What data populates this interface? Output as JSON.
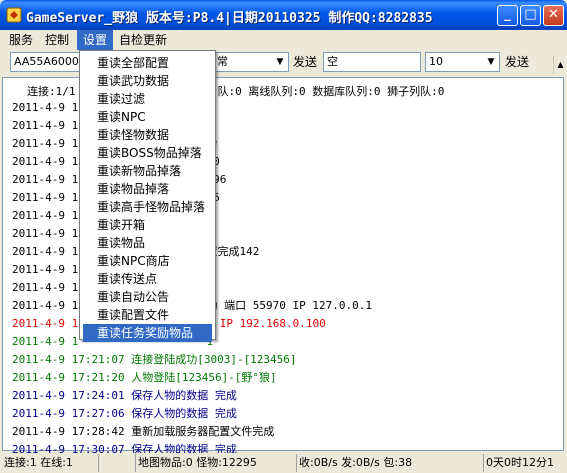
{
  "window": {
    "title": "GameServer_野狼 版本号:P8.4|日期20110325 制作QQ:8282835",
    "buttons": {
      "minimize": "_",
      "maximize": "□",
      "close": "✕"
    }
  },
  "menu": [
    {
      "label": "服务"
    },
    {
      "label": "控制"
    },
    {
      "label": "设置"
    },
    {
      "label": "自检更新"
    }
  ],
  "toolbar": {
    "combo1_value": "AA55A60000",
    "combo2_value": "常",
    "send1_label": "发送",
    "text_value": "空",
    "combo3_value": "10",
    "send2_label": "发送"
  },
  "dropdown": {
    "items": [
      "重读全部配置",
      "重读武功数据",
      "重读过滤",
      "重读NPC",
      "重读怪物数据",
      "重读BOSS物品掉落",
      "重读新物品掉落",
      "重读物品掉落",
      "重读高手怪物品掉落",
      "重读开箱",
      "重读物品",
      "重读NPC商店",
      "重读传送点",
      "重读自动公告",
      "重读配置文件",
      "重读任务奖励物品"
    ],
    "highlighted_index": 15
  },
  "log": {
    "connection_line_left": "连接:1/1",
    "connection_line_right": "队:0 离线队列:0 数据库队列:0 狮子列队:0",
    "lines": [
      {
        "left": "2011-4-9  1",
        "right": "",
        "color": "black"
      },
      {
        "left": "2011-4-9  1",
        "right": "",
        "color": "black"
      },
      {
        "left": "2011-4-9  1",
        "right": "会",
        "color": "black"
      },
      {
        "left": "2011-4-9  1",
        "right": "50",
        "color": "black"
      },
      {
        "left": "2011-4-9  1",
        "right": "896",
        "color": "black"
      },
      {
        "left": "2011-4-9  1",
        "right": "36",
        "color": "black"
      },
      {
        "left": "2011-4-9  1",
        "right": "4",
        "color": "black"
      },
      {
        "left": "2011-4-9  1",
        "right": "5",
        "color": "black"
      },
      {
        "left": "2011-4-9  1",
        "right": "置完成142",
        "color": "black"
      },
      {
        "left": "2011-4-9  1",
        "right": "",
        "color": "black"
      },
      {
        "left": "2011-4-9  1",
        "right": "1",
        "color": "black"
      },
      {
        "left": "2011-4-9  1",
        "right": "功 端口 55970 IP 127.0.0.1",
        "color": "black"
      },
      {
        "left": "2011-4-9  1",
        "right": "0 IP 192.168.0.100",
        "color": "red"
      },
      {
        "left": "2011-4-9  1",
        "right": "1",
        "color": "green"
      },
      {
        "left": "2011-4-9  17:21:07 连接登陆成功[3003]-[123456]",
        "right": "",
        "color": "green"
      },
      {
        "left": "2011-4-9  17:21:20 人物登陆[123456]-[野°狼]",
        "right": "",
        "color": "green"
      },
      {
        "left": "2011-4-9  17:24:01 保存人物的数据 完成",
        "right": "",
        "color": "blue"
      },
      {
        "left": "2011-4-9  17:27:06 保存人物的数据 完成",
        "right": "",
        "color": "blue"
      },
      {
        "left": "2011-4-9  17:28:42 重新加载服务器配置文件完成",
        "right": "",
        "color": "black"
      },
      {
        "left": "2011-4-9  17:30:07 保存人物的数据 完成",
        "right": "",
        "color": "blue"
      }
    ]
  },
  "statusbar": [
    "连接:1 在线:1",
    "",
    "地图物品:0 怪物:12295",
    "收:0B/s 发:0B/s 包:38",
    "0天0时12分1"
  ]
}
